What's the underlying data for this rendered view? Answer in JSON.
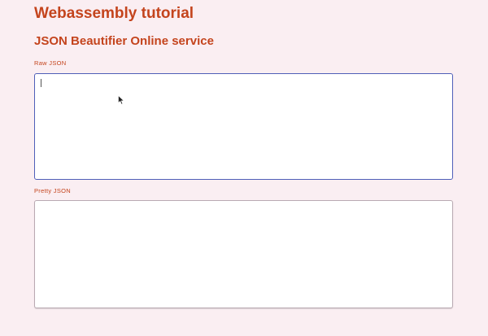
{
  "header": {
    "title": "Webassembly tutorial",
    "subtitle": "JSON Beautifier Online service"
  },
  "raw_json": {
    "label": "Raw JSON",
    "value": ""
  },
  "pretty_json": {
    "label": "Pretty JSON",
    "value": ""
  },
  "colors": {
    "accent": "#c4441d",
    "background": "#faeef2",
    "focus_border": "#4f5fb8"
  }
}
